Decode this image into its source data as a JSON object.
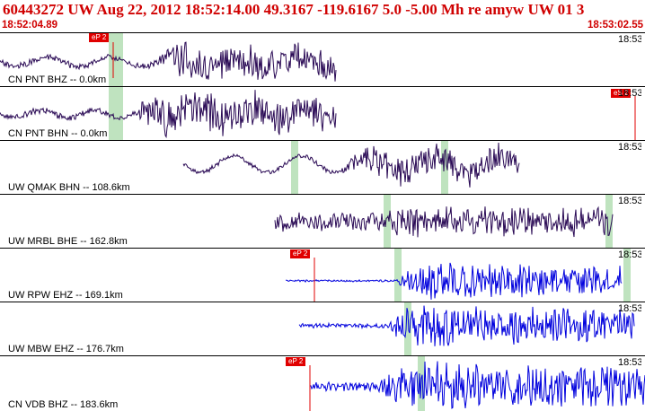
{
  "header": {
    "title": "60443272  UW  Aug 22, 2012  18:52:14.00    49.3167  -119.6167   5.0  -5.00  Mh  re  amyw  UW  01    3",
    "start_time": "18:52:04.89",
    "end_time": "18:53:02.55"
  },
  "colors": {
    "header_text": "#d00000",
    "trace_dark": "#2a0a55",
    "trace_blue": "#0000dd",
    "pick_marker": "#e00000",
    "phase_window": "#bfe3bf"
  },
  "traces": [
    {
      "label": "CN PNT BHZ -- 0.0km",
      "time_label": "18:53",
      "pick_label": "eP 2"
    },
    {
      "label": "CN PNT BHN -- 0.0km",
      "time_label": "18:53",
      "pick_label": "eS 2"
    },
    {
      "label": "UW QMAK BHN -- 108.6km",
      "time_label": "18:53",
      "pick_label": ""
    },
    {
      "label": "UW MRBL BHE -- 162.8km",
      "time_label": "18:53",
      "pick_label": ""
    },
    {
      "label": "UW RPW EHZ -- 169.1km",
      "time_label": "18:53",
      "pick_label": "eP 2"
    },
    {
      "label": "UW MBW EHZ -- 176.7km",
      "time_label": "18:53",
      "pick_label": ""
    },
    {
      "label": "CN VDB BHZ -- 183.6km",
      "time_label": "18:53",
      "pick_label": "eP 2"
    }
  ]
}
